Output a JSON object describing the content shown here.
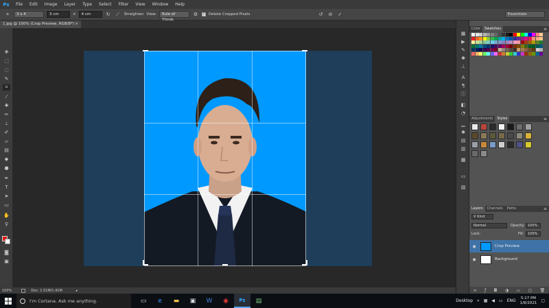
{
  "menubar": {
    "logo": "Ps",
    "items": [
      "File",
      "Edit",
      "Image",
      "Layer",
      "Type",
      "Select",
      "Filter",
      "View",
      "Window",
      "Help"
    ]
  },
  "options": {
    "ratio_preset": "3 x 4",
    "width": "3 cm",
    "swap_symbol": "×",
    "height": "4 cm",
    "straighten_label": "Straighten",
    "view_label": "View:",
    "view_value": "Rule of Thirds",
    "delete_cropped_label": "Delete Cropped Pixels",
    "workspace": "Essentials"
  },
  "document": {
    "tab_title": "1.jpg @ 100% (Crop Preview, RGB/8*)",
    "tab_close": "×",
    "zoom": "100%",
    "doc_info": "Doc: 1.51M/1.41M"
  },
  "panels": {
    "color_tabs": [
      "Color",
      "Swatches"
    ],
    "adjust_tabs": [
      "Adjustments",
      "Styles"
    ],
    "layers_tabs": [
      "Layers",
      "Channels",
      "Paths"
    ],
    "kind_label": "Kind",
    "blend_mode": "Normal",
    "opacity_label": "Opacity:",
    "opacity_value": "100%",
    "lock_label": "Lock:",
    "fill_label": "Fill:",
    "fill_value": "100%",
    "layers": [
      {
        "name": "Crop Preview",
        "thumb_color": "#0099ff"
      },
      {
        "name": "Background",
        "thumb_color": "#ffffff"
      }
    ]
  },
  "swatch_colors": [
    "#ffffff",
    "#e6e6e6",
    "#cccccc",
    "#b3b3b3",
    "#999999",
    "#808080",
    "#666666",
    "#4d4d4d",
    "#333333",
    "#1a1a1a",
    "#000000",
    "#ff0000",
    "#ffff00",
    "#00ff00",
    "#00ffff",
    "#0000ff",
    "#ff00ff",
    "#ff8080",
    "#ffcc99",
    "#ed1c24",
    "#f26522",
    "#f7941d",
    "#fff200",
    "#8dc63f",
    "#39b54a",
    "#00a651",
    "#00a99d",
    "#00aeef",
    "#0072bc",
    "#0054a6",
    "#2e3192",
    "#662d91",
    "#92278f",
    "#ec008c",
    "#ed145b",
    "#f69679",
    "#f9ad81",
    "#fdc689",
    "#fff799",
    "#c4df9b",
    "#a3d39c",
    "#82ca9c",
    "#7accc8",
    "#6dcff6",
    "#7da7d9",
    "#8393ca",
    "#8781bd",
    "#a186be",
    "#bd8cbf",
    "#f49ac1",
    "#f5989d",
    "#9e0b0f",
    "#a0410d",
    "#a36209",
    "#aba000",
    "#598527",
    "#1a7b30",
    "#007236",
    "#00746b",
    "#0076a3",
    "#004b80",
    "#003471",
    "#1b1464",
    "#440e62",
    "#630460",
    "#9e005d",
    "#9e0039",
    "#790000",
    "#7b2e00",
    "#7d4900",
    "#827b00",
    "#406618",
    "#005e20",
    "#005826",
    "#005952",
    "#005b7f",
    "#003663",
    "#002157",
    "#0d004c",
    "#32004b",
    "#4b0049",
    "#7b0046",
    "#7a0026",
    "#c7b299",
    "#998675",
    "#736357",
    "#534741",
    "#37302d",
    "#c69c6d",
    "#a67c52",
    "#8c6239",
    "#754c24",
    "#603913",
    "#cfcfcf",
    "#b0b0b0",
    "#ff6666",
    "#ffb366",
    "#ffff66",
    "#66ff66",
    "#66ffff",
    "#6666ff",
    "#ff66ff",
    "#cc3333",
    "#cc8033",
    "#cccc33",
    "#33cc33",
    "#33cccc",
    "#3333cc",
    "#cc33cc",
    "#993300",
    "#996600",
    "#669900",
    "#006699",
    "#660099"
  ],
  "style_colors": [
    "#e8e8e8",
    "#b8463a",
    "#2b2b2b",
    "#f2f2f2",
    "#1a1a1a",
    "#6c6c6c",
    "#a0a0a0",
    "#5a4a2a",
    "#8a7a5a",
    "#5a5a3a",
    "#7a6a4a",
    "#4a4a4a",
    "#8a8a7a",
    "#d9b13a",
    "#9aa0a8",
    "#c8883a",
    "#7a9ac8",
    "#d0d0d0",
    "#2a2a2a",
    "#505088",
    "#d4c830",
    "#6a6a6a",
    "#8a8a8a"
  ],
  "taskbar": {
    "search_placeholder": "I'm Cortana. Ask me anything.",
    "desktop_label": "Desktop",
    "language": "ENG",
    "time": "5:17 PM",
    "date": "1/8/2021"
  }
}
